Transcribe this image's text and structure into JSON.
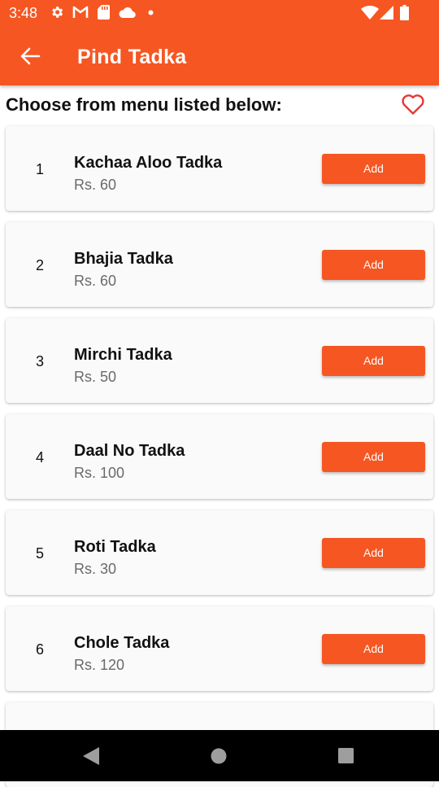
{
  "status_bar": {
    "time": "3:48",
    "left_icons": [
      "gear-icon",
      "gmail-icon",
      "sd-card-icon",
      "cloud-icon",
      "dot-icon"
    ],
    "right_icons": [
      "wifi-icon",
      "signal-icon",
      "battery-icon"
    ]
  },
  "toolbar": {
    "back_icon": "arrow-left-icon",
    "title": "Pind Tadka",
    "background_color": "#F65622"
  },
  "menu": {
    "heading": "Choose from menu listed below:",
    "favorite_icon": "heart-outline-icon",
    "items": [
      {
        "number": "1",
        "name": "Kachaa Aloo Tadka",
        "price": "Rs. 60",
        "button_label": "Add"
      },
      {
        "number": "2",
        "name": "Bhajia Tadka",
        "price": "Rs. 60",
        "button_label": "Add"
      },
      {
        "number": "3",
        "name": "Mirchi Tadka",
        "price": "Rs. 50",
        "button_label": "Add"
      },
      {
        "number": "4",
        "name": "Daal No Tadka",
        "price": "Rs. 100",
        "button_label": "Add"
      },
      {
        "number": "5",
        "name": "Roti Tadka",
        "price": "Rs. 30",
        "button_label": "Add"
      },
      {
        "number": "6",
        "name": "Chole Tadka",
        "price": "Rs. 120",
        "button_label": "Add"
      }
    ]
  },
  "colors": {
    "accent": "#F65622",
    "heart": "#E53935",
    "card_background": "#FAFAFA",
    "price_text": "#6A6A6A"
  },
  "nav_bar": {
    "buttons": [
      "back-triangle-icon",
      "home-circle-icon",
      "recents-square-icon"
    ]
  }
}
